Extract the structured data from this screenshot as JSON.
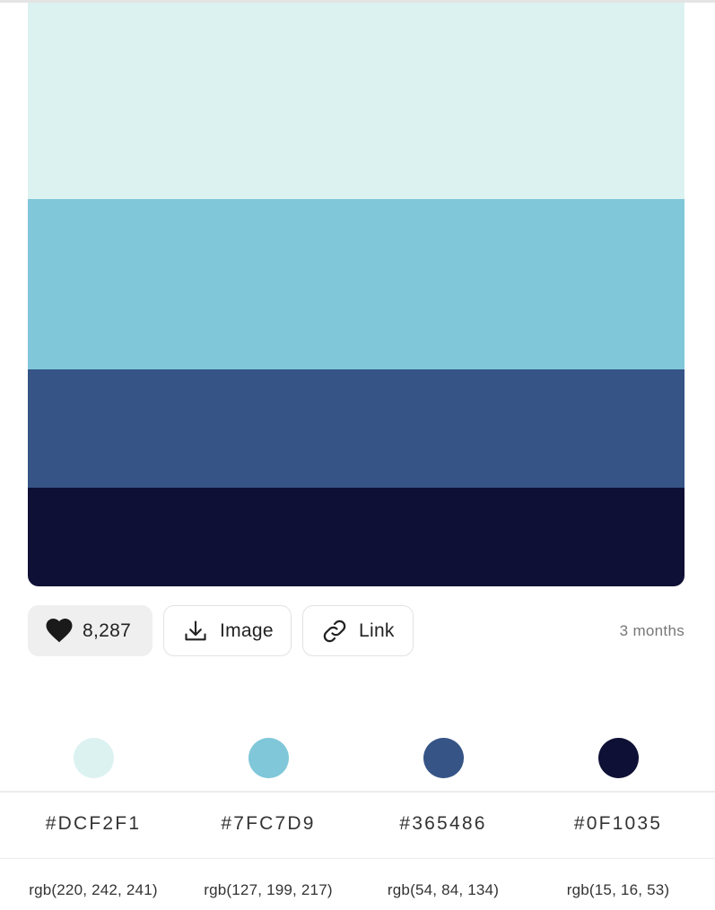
{
  "colors": [
    {
      "hex": "#DCF2F1",
      "rgb": "rgb(220, 242, 241)",
      "swatch": "#dcf2f1"
    },
    {
      "hex": "#7FC7D9",
      "rgb": "rgb(127, 199, 217)",
      "swatch": "#7fc7d9"
    },
    {
      "hex": "#365486",
      "rgb": "rgb(54, 84, 134)",
      "swatch": "#365486"
    },
    {
      "hex": "#0F1035",
      "rgb": "rgb(15, 16, 53)",
      "swatch": "#0f1035"
    }
  ],
  "actions": {
    "likes": "8,287",
    "image_label": "Image",
    "link_label": "Link",
    "age": "3 months"
  },
  "icons": {
    "like": "heart-icon",
    "image": "download-icon",
    "link": "link-icon"
  }
}
